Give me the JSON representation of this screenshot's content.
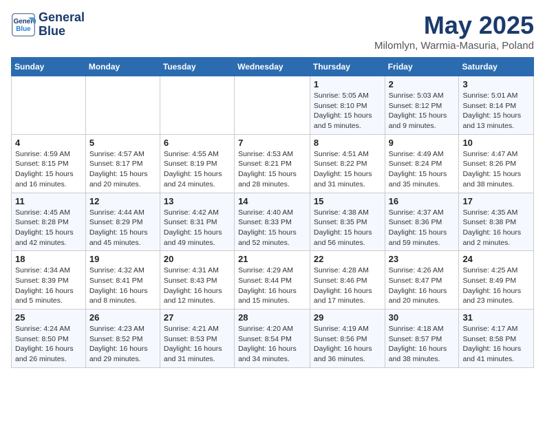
{
  "header": {
    "logo_line1": "General",
    "logo_line2": "Blue",
    "title": "May 2025",
    "subtitle": "Milomlyn, Warmia-Masuria, Poland"
  },
  "days_of_week": [
    "Sunday",
    "Monday",
    "Tuesday",
    "Wednesday",
    "Thursday",
    "Friday",
    "Saturday"
  ],
  "weeks": [
    [
      {
        "day": "",
        "info": ""
      },
      {
        "day": "",
        "info": ""
      },
      {
        "day": "",
        "info": ""
      },
      {
        "day": "",
        "info": ""
      },
      {
        "day": "1",
        "info": "Sunrise: 5:05 AM\nSunset: 8:10 PM\nDaylight: 15 hours\nand 5 minutes."
      },
      {
        "day": "2",
        "info": "Sunrise: 5:03 AM\nSunset: 8:12 PM\nDaylight: 15 hours\nand 9 minutes."
      },
      {
        "day": "3",
        "info": "Sunrise: 5:01 AM\nSunset: 8:14 PM\nDaylight: 15 hours\nand 13 minutes."
      }
    ],
    [
      {
        "day": "4",
        "info": "Sunrise: 4:59 AM\nSunset: 8:15 PM\nDaylight: 15 hours\nand 16 minutes."
      },
      {
        "day": "5",
        "info": "Sunrise: 4:57 AM\nSunset: 8:17 PM\nDaylight: 15 hours\nand 20 minutes."
      },
      {
        "day": "6",
        "info": "Sunrise: 4:55 AM\nSunset: 8:19 PM\nDaylight: 15 hours\nand 24 minutes."
      },
      {
        "day": "7",
        "info": "Sunrise: 4:53 AM\nSunset: 8:21 PM\nDaylight: 15 hours\nand 28 minutes."
      },
      {
        "day": "8",
        "info": "Sunrise: 4:51 AM\nSunset: 8:22 PM\nDaylight: 15 hours\nand 31 minutes."
      },
      {
        "day": "9",
        "info": "Sunrise: 4:49 AM\nSunset: 8:24 PM\nDaylight: 15 hours\nand 35 minutes."
      },
      {
        "day": "10",
        "info": "Sunrise: 4:47 AM\nSunset: 8:26 PM\nDaylight: 15 hours\nand 38 minutes."
      }
    ],
    [
      {
        "day": "11",
        "info": "Sunrise: 4:45 AM\nSunset: 8:28 PM\nDaylight: 15 hours\nand 42 minutes."
      },
      {
        "day": "12",
        "info": "Sunrise: 4:44 AM\nSunset: 8:29 PM\nDaylight: 15 hours\nand 45 minutes."
      },
      {
        "day": "13",
        "info": "Sunrise: 4:42 AM\nSunset: 8:31 PM\nDaylight: 15 hours\nand 49 minutes."
      },
      {
        "day": "14",
        "info": "Sunrise: 4:40 AM\nSunset: 8:33 PM\nDaylight: 15 hours\nand 52 minutes."
      },
      {
        "day": "15",
        "info": "Sunrise: 4:38 AM\nSunset: 8:35 PM\nDaylight: 15 hours\nand 56 minutes."
      },
      {
        "day": "16",
        "info": "Sunrise: 4:37 AM\nSunset: 8:36 PM\nDaylight: 15 hours\nand 59 minutes."
      },
      {
        "day": "17",
        "info": "Sunrise: 4:35 AM\nSunset: 8:38 PM\nDaylight: 16 hours\nand 2 minutes."
      }
    ],
    [
      {
        "day": "18",
        "info": "Sunrise: 4:34 AM\nSunset: 8:39 PM\nDaylight: 16 hours\nand 5 minutes."
      },
      {
        "day": "19",
        "info": "Sunrise: 4:32 AM\nSunset: 8:41 PM\nDaylight: 16 hours\nand 8 minutes."
      },
      {
        "day": "20",
        "info": "Sunrise: 4:31 AM\nSunset: 8:43 PM\nDaylight: 16 hours\nand 12 minutes."
      },
      {
        "day": "21",
        "info": "Sunrise: 4:29 AM\nSunset: 8:44 PM\nDaylight: 16 hours\nand 15 minutes."
      },
      {
        "day": "22",
        "info": "Sunrise: 4:28 AM\nSunset: 8:46 PM\nDaylight: 16 hours\nand 17 minutes."
      },
      {
        "day": "23",
        "info": "Sunrise: 4:26 AM\nSunset: 8:47 PM\nDaylight: 16 hours\nand 20 minutes."
      },
      {
        "day": "24",
        "info": "Sunrise: 4:25 AM\nSunset: 8:49 PM\nDaylight: 16 hours\nand 23 minutes."
      }
    ],
    [
      {
        "day": "25",
        "info": "Sunrise: 4:24 AM\nSunset: 8:50 PM\nDaylight: 16 hours\nand 26 minutes."
      },
      {
        "day": "26",
        "info": "Sunrise: 4:23 AM\nSunset: 8:52 PM\nDaylight: 16 hours\nand 29 minutes."
      },
      {
        "day": "27",
        "info": "Sunrise: 4:21 AM\nSunset: 8:53 PM\nDaylight: 16 hours\nand 31 minutes."
      },
      {
        "day": "28",
        "info": "Sunrise: 4:20 AM\nSunset: 8:54 PM\nDaylight: 16 hours\nand 34 minutes."
      },
      {
        "day": "29",
        "info": "Sunrise: 4:19 AM\nSunset: 8:56 PM\nDaylight: 16 hours\nand 36 minutes."
      },
      {
        "day": "30",
        "info": "Sunrise: 4:18 AM\nSunset: 8:57 PM\nDaylight: 16 hours\nand 38 minutes."
      },
      {
        "day": "31",
        "info": "Sunrise: 4:17 AM\nSunset: 8:58 PM\nDaylight: 16 hours\nand 41 minutes."
      }
    ]
  ]
}
